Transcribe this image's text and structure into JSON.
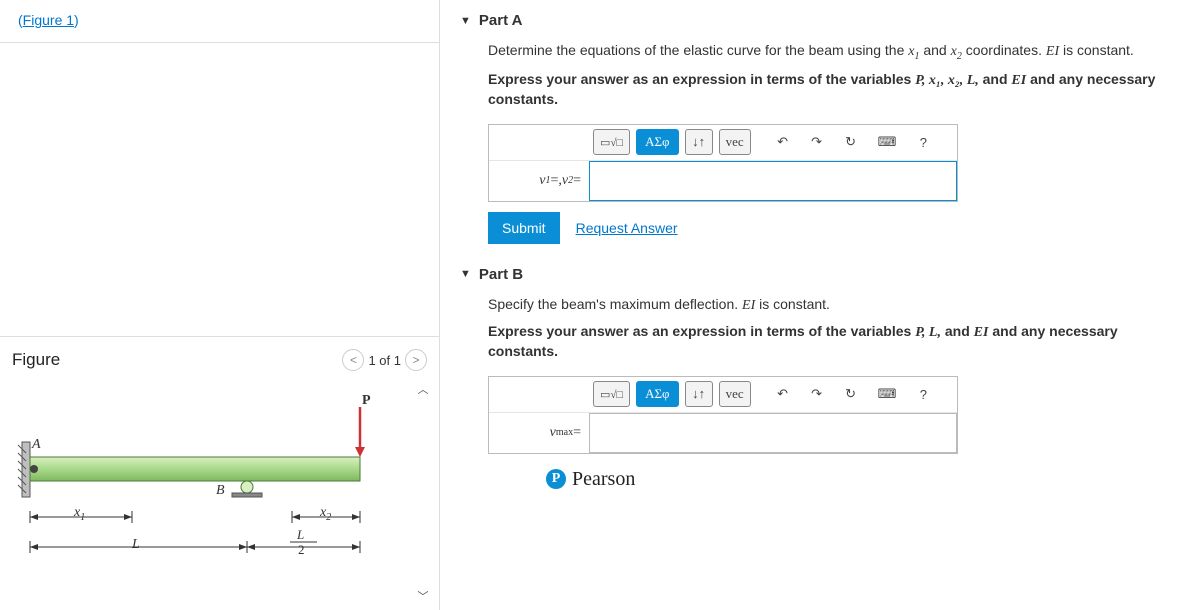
{
  "left": {
    "figure_link": "(Figure 1)",
    "figure_title": "Figure",
    "pager": "1 of 1",
    "labels": {
      "P": "P",
      "A": "A",
      "B": "B",
      "x1": "x",
      "x1sub": "1",
      "x2": "x",
      "x2sub": "2",
      "L": "L",
      "Lhalf_top": "L",
      "Lhalf_bot": "2"
    }
  },
  "partA": {
    "title": "Part A",
    "prompt1_a": "Determine the equations of the elastic curve for the beam using the ",
    "prompt1_b": " and ",
    "prompt1_c": " coordinates. ",
    "prompt1_d": " is constant.",
    "x1": "x",
    "x1s": "1",
    "x2": "x",
    "x2s": "2",
    "EI": "EI",
    "prompt2_a": "Express your answer as an expression in terms of the variables ",
    "prompt2_b": " and any necessary constants.",
    "vars": "P, x₁, x₂, L,",
    "and": " and ",
    "EI2": "EI",
    "label_a": "v",
    "label_a_s": "1",
    "label_eq": " =, ",
    "label_b": "v",
    "label_b_s": "2",
    "label_eq2": " =",
    "submit": "Submit",
    "request": "Request Answer"
  },
  "partB": {
    "title": "Part B",
    "prompt1_a": "Specify the beam's maximum deflection. ",
    "prompt1_b": " is constant.",
    "EI": "EI",
    "prompt2_a": "Express your answer as an expression in terms of the variables ",
    "prompt2_b": " and any necessary constants.",
    "vars": "P, L,",
    "and": " and ",
    "EI2": "EI",
    "label": "v",
    "label_sub": "max",
    "label_eq": " ="
  },
  "toolbar": {
    "tmpl": "□",
    "sqrt": "√□",
    "greek": "ΑΣφ",
    "arrows": "↓↑",
    "vec": "vec",
    "undo": "↶",
    "redo": "↷",
    "reset": "↻",
    "kbd": "⌨",
    "help": "?"
  },
  "pearson": {
    "P": "P",
    "name": "Pearson"
  }
}
